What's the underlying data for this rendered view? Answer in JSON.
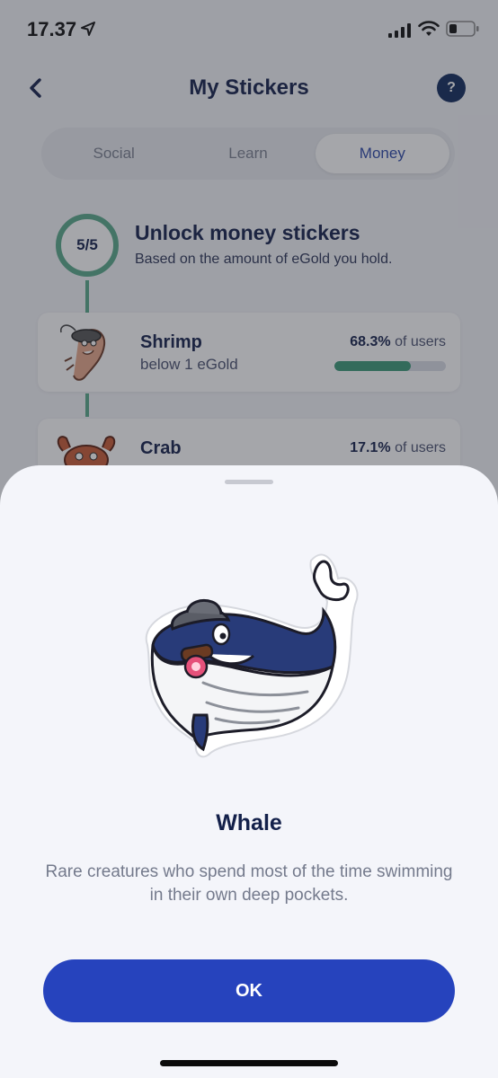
{
  "status_bar": {
    "time": "17.37"
  },
  "header": {
    "title": "My Stickers",
    "help_label": "?"
  },
  "tabs": [
    {
      "label": "Social",
      "active": false
    },
    {
      "label": "Learn",
      "active": false
    },
    {
      "label": "Money",
      "active": true
    }
  ],
  "progress": {
    "count": "5/5",
    "title": "Unlock money stickers",
    "subtitle": "Based on the amount of eGold you hold."
  },
  "stickers": [
    {
      "name": "Shrimp",
      "requirement": "below 1 eGold",
      "percent": "68.3%",
      "percent_suffix": "of users",
      "fill": 0.683
    },
    {
      "name": "Crab",
      "percent": "17.1%",
      "percent_suffix": "of users",
      "fill": 0.171
    }
  ],
  "sheet": {
    "sticker_name": "Whale",
    "description": "Rare creatures who spend most of the time swimming in their own deep pockets.",
    "ok_label": "OK"
  },
  "colors": {
    "accent": "#2643bd",
    "progress_green": "#58a98a",
    "title_navy": "#13204a"
  }
}
